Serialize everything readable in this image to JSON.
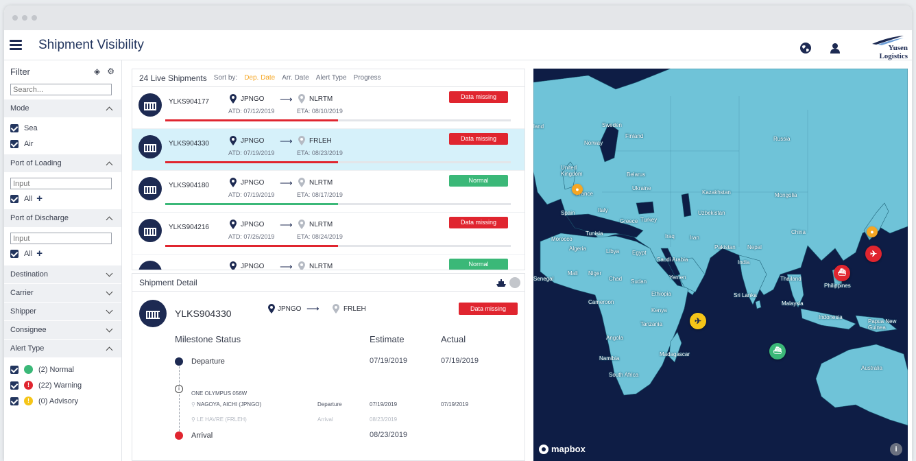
{
  "app": {
    "title": "Shipment Visibility",
    "logo_text": "Yusen Logistics"
  },
  "filter": {
    "title": "Filter",
    "search_placeholder": "Search...",
    "mode": {
      "label": "Mode",
      "options": [
        "Sea",
        "Air"
      ]
    },
    "port_of_loading": {
      "label": "Port of Loading",
      "placeholder": "Input",
      "all_label": "All"
    },
    "port_of_discharge": {
      "label": "Port of Discharge",
      "placeholder": "Input",
      "all_label": "All"
    },
    "collapsed_sections": [
      "Destination",
      "Carrier",
      "Shipper",
      "Consignee"
    ],
    "alert_type": {
      "label": "Alert Type",
      "options": [
        {
          "label": "(2) Normal",
          "color": "#3bb878",
          "glyph": ""
        },
        {
          "label": "(22) Warning",
          "color": "#e0252f",
          "glyph": "!"
        },
        {
          "label": "(0) Advisory",
          "color": "#f5c518",
          "glyph": "!"
        }
      ]
    }
  },
  "shipments": {
    "count_label": "24 Live Shipments",
    "sort_label": "Sort by:",
    "sort_options": [
      "Dep. Date",
      "Arr. Date",
      "Alert Type",
      "Progress"
    ],
    "active_sort": "Dep. Date",
    "rows": [
      {
        "id": "YLKS904177",
        "from": "JPNGO",
        "to": "NLRTM",
        "atd": "ATD: 07/12/2019",
        "eta": "ETA: 08/10/2019",
        "status": "Data missing",
        "status_color": "red",
        "progress": 0.5
      },
      {
        "id": "YLKS904330",
        "from": "JPNGO",
        "to": "FRLEH",
        "atd": "ATD: 07/19/2019",
        "eta": "ETA: 08/23/2019",
        "status": "Data missing",
        "status_color": "red",
        "progress": 0.5,
        "selected": true
      },
      {
        "id": "YLKS904180",
        "from": "JPNGO",
        "to": "NLRTM",
        "atd": "ATD: 07/19/2019",
        "eta": "ETA: 08/17/2019",
        "status": "Normal",
        "status_color": "green",
        "progress": 0.5
      },
      {
        "id": "YLKS904216",
        "from": "JPNGO",
        "to": "NLRTM",
        "atd": "ATD: 07/26/2019",
        "eta": "ETA: 08/24/2019",
        "status": "Data missing",
        "status_color": "red",
        "progress": 0.5
      },
      {
        "id": "",
        "from": "JPNGO",
        "to": "NLRTM",
        "atd": "",
        "eta": "",
        "status": "Normal",
        "status_color": "green",
        "progress": 0.5
      }
    ]
  },
  "detail": {
    "title": "Shipment Detail",
    "id": "YLKS904330",
    "from": "JPNGO",
    "to": "FRLEH",
    "status": "Data missing",
    "milestone_header": "Milestone Status",
    "estimate_header": "Estimate",
    "actual_header": "Actual",
    "departure": {
      "label": "Departure",
      "estimate": "07/19/2019",
      "actual": "07/19/2019"
    },
    "vessel": "ONE OLYMPUS 056W",
    "leg_from": {
      "place": "NAGOYA, AICHI (JPNGO)",
      "type": "Departure",
      "estimate": "07/19/2019",
      "actual": "07/19/2019"
    },
    "leg_to": {
      "place": "LE HAVRE (FRLEH)",
      "type": "Arrival",
      "estimate": "08/23/2019"
    },
    "arrival": {
      "label": "Arrival",
      "estimate": "08/23/2019"
    }
  },
  "map": {
    "attribution": "mapbox",
    "labels": [
      "land",
      "Sweden",
      "Finland",
      "Norway",
      "Russia",
      "United Kingdom",
      "Belarus",
      "Ukraine",
      "Kazakhstan",
      "Mongolia",
      "France",
      "Spain",
      "Italy",
      "Greece",
      "Turkey",
      "Uzbekistan",
      "China",
      "Morocco",
      "Tunisia",
      "Iraq",
      "Iran",
      "Algeria",
      "Libya",
      "Egypt",
      "Pakistan",
      "Nepal",
      "India",
      "Saudi Arabia",
      "Senegal",
      "Mali",
      "Niger",
      "Chad",
      "Sudan",
      "Yemen",
      "Thailand",
      "Philippines",
      "Ethiopia",
      "Sri Lanka",
      "Cameroon",
      "Kenya",
      "Malaysia",
      "Indonesia",
      "Papua New Guinea",
      "Tanzania",
      "Angola",
      "Namibia",
      "Madagascar",
      "South Africa",
      "Australia"
    ]
  },
  "colors": {
    "navy": "#1d2a52",
    "land": "#6fc3d8",
    "ocean": "#0e1d45",
    "red": "#e0252f",
    "green": "#3bb878",
    "orange": "#f5a623"
  }
}
